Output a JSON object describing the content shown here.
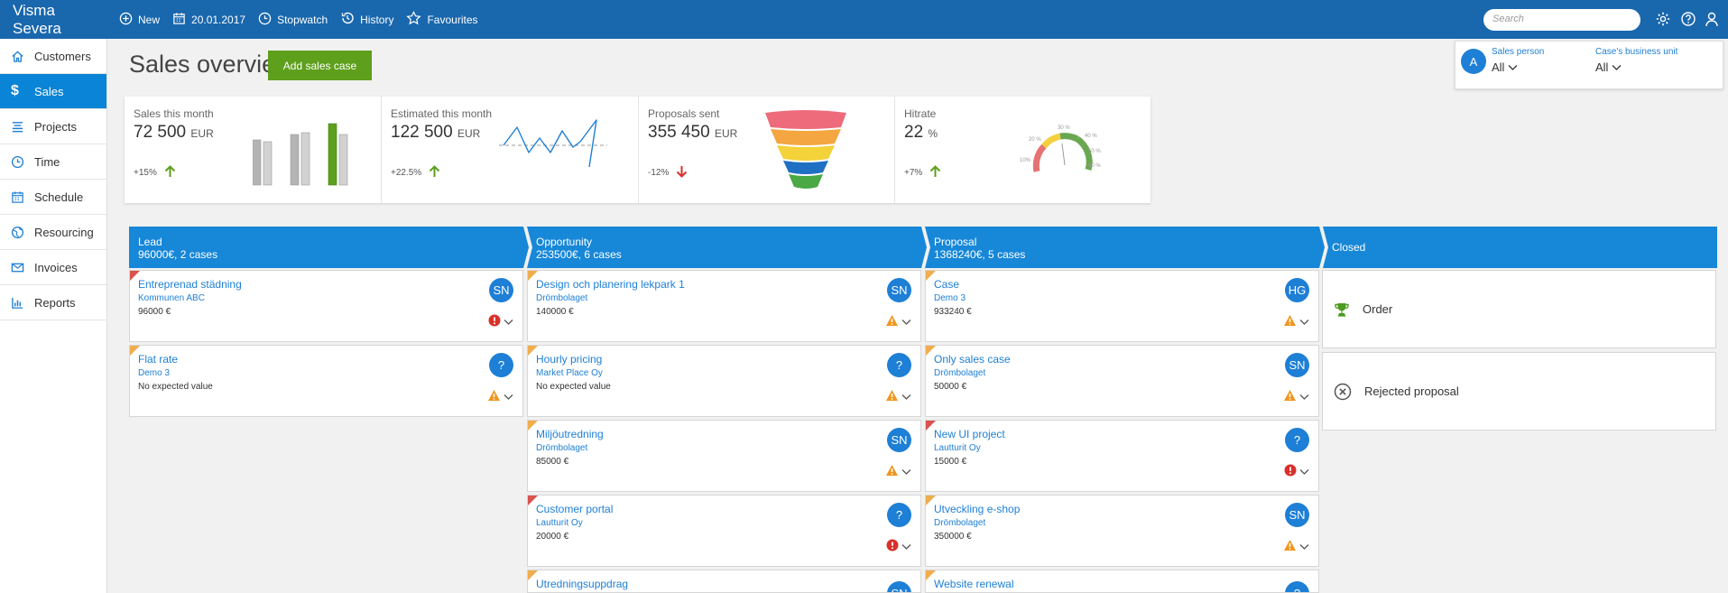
{
  "topbar": {
    "brand": "Visma Severa",
    "items": [
      {
        "icon": "plus-circle-icon",
        "label": "New"
      },
      {
        "icon": "calendar-icon",
        "label": "20.01.2017"
      },
      {
        "icon": "stopwatch-icon",
        "label": "Stopwatch"
      },
      {
        "icon": "history-icon",
        "label": "History"
      },
      {
        "icon": "star-icon",
        "label": "Favourites"
      }
    ],
    "search_placeholder": "Search"
  },
  "sidebar": {
    "items": [
      {
        "label": "Customers",
        "icon": "home-icon"
      },
      {
        "label": "Sales",
        "icon": "dollar-icon",
        "active": true
      },
      {
        "label": "Projects",
        "icon": "projects-icon"
      },
      {
        "label": "Time",
        "icon": "clock-icon"
      },
      {
        "label": "Schedule",
        "icon": "calendar-icon"
      },
      {
        "label": "Resourcing",
        "icon": "globe-icon"
      },
      {
        "label": "Invoices",
        "icon": "envelope-icon"
      },
      {
        "label": "Reports",
        "icon": "bar-chart-icon"
      }
    ]
  },
  "header": {
    "title": "Sales overview",
    "add_button": "Add sales case"
  },
  "filters": {
    "avatar_letter": "A",
    "sales_person_label": "Sales person",
    "sales_person_value": "All",
    "business_unit_label": "Case's business unit",
    "business_unit_value": "All"
  },
  "kpis": [
    {
      "label": "Sales this month",
      "value": "72 500",
      "unit": "EUR",
      "change": "+15%",
      "trend": "up"
    },
    {
      "label": "Estimated this month",
      "value": "122 500",
      "unit": "EUR",
      "change": "+22.5%",
      "trend": "up"
    },
    {
      "label": "Proposals sent",
      "value": "355 450",
      "unit": "EUR",
      "change": "-12%",
      "trend": "down"
    },
    {
      "label": "Hitrate",
      "value": "22",
      "unit": "%",
      "change": "+7%",
      "trend": "up"
    }
  ],
  "gauge_labels": [
    "10%",
    "20 %",
    "30 %",
    "40 %",
    "50 %",
    "60 %"
  ],
  "stages": [
    {
      "name": "Lead",
      "summary": "96000€, 2 cases"
    },
    {
      "name": "Opportunity",
      "summary": "253500€, 6 cases"
    },
    {
      "name": "Proposal",
      "summary": "1368240€, 5 cases"
    },
    {
      "name": "Closed",
      "summary": ""
    }
  ],
  "cards": {
    "lead": [
      {
        "title": "Entreprenad städning",
        "company": "Kommunen ABC",
        "value": "96000 €",
        "owner": "SN",
        "flag": "red",
        "status": "error"
      },
      {
        "title": "Flat rate",
        "company": "Demo 3",
        "value": "No expected value",
        "owner": "?",
        "flag": "orange",
        "status": "warning"
      }
    ],
    "opportunity": [
      {
        "title": "Design och planering lekpark 1",
        "company": "Drömbolaget",
        "value": "140000 €",
        "owner": "SN",
        "flag": "orange",
        "status": "warning"
      },
      {
        "title": "Hourly pricing",
        "company": "Market Place Oy",
        "value": "No expected value",
        "owner": "?",
        "flag": "orange",
        "status": "warning"
      },
      {
        "title": "Miljöutredning",
        "company": "Drömbolaget",
        "value": "85000 €",
        "owner": "SN",
        "flag": "orange",
        "status": "warning"
      },
      {
        "title": "Customer portal",
        "company": "Lautturit Oy",
        "value": "20000 €",
        "owner": "?",
        "flag": "red",
        "status": "error"
      },
      {
        "title": "Utredningsuppdrag",
        "company": "",
        "value": "",
        "owner": "SN",
        "flag": "orange",
        "status": ""
      }
    ],
    "proposal": [
      {
        "title": "Case",
        "company": "Demo 3",
        "value": "933240 €",
        "owner": "HG",
        "flag": "orange",
        "status": "warning"
      },
      {
        "title": "Only sales case",
        "company": "Drömbolaget",
        "value": "50000 €",
        "owner": "SN",
        "flag": "orange",
        "status": "warning"
      },
      {
        "title": "New UI project",
        "company": "Lautturit Oy",
        "value": "15000 €",
        "owner": "?",
        "flag": "red",
        "status": "error"
      },
      {
        "title": "Utveckling e-shop",
        "company": "Drömbolaget",
        "value": "350000 €",
        "owner": "SN",
        "flag": "orange",
        "status": "warning"
      },
      {
        "title": "Website renewal",
        "company": "",
        "value": "",
        "owner": "?",
        "flag": "orange",
        "status": ""
      }
    ],
    "closed": [
      {
        "label": "Order",
        "icon": "trophy-icon"
      },
      {
        "label": "Rejected proposal",
        "icon": "x-circle-icon"
      }
    ]
  },
  "colors": {
    "topbar": "#1967ad",
    "accent": "#1787d8",
    "add_button": "#5e9f1c",
    "flag_red": "#d9534f",
    "flag_orange": "#f0ad4e",
    "trend_up": "#5e9f1c",
    "trend_down": "#d9302a"
  }
}
